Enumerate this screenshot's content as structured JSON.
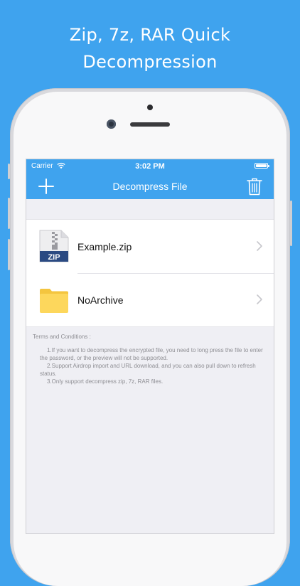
{
  "promo": {
    "line1": "Zip, 7z, RAR Quick",
    "line2": "Decompression"
  },
  "statusbar": {
    "carrier": "Carrier",
    "time": "3:02 PM"
  },
  "navbar": {
    "title": "Decompress File",
    "add_icon": "plus-icon",
    "trash_icon": "trash-icon"
  },
  "files": [
    {
      "name": "Example.zip",
      "icon": "zip-file-icon",
      "badge": "ZIP"
    },
    {
      "name": "NoArchive",
      "icon": "folder-icon"
    }
  ],
  "terms": {
    "heading": "Terms and Conditions :",
    "items": [
      "1.If you want to decompress the encrypted file, you need to long press the file to enter the password, or the preview will not be supported.",
      "2.Support Airdrop import and URL download, and you can also pull down to refresh status.",
      "3.Only support decompress zip, 7z, RAR files."
    ]
  },
  "colors": {
    "background": "#3fa3ee",
    "navbar": "#3fa3ee",
    "folder": "#fdd75c",
    "zip_badge": "#2b4a82"
  }
}
